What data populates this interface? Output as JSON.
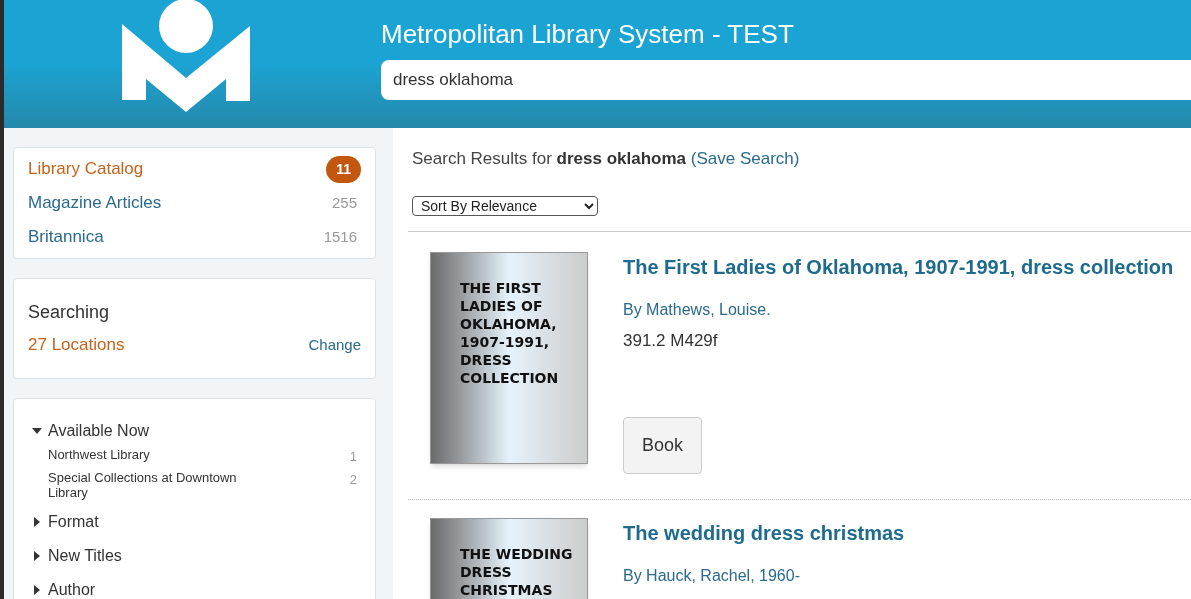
{
  "header": {
    "title": "Metropolitan Library System - TEST",
    "search": {
      "value": "dress oklahoma"
    }
  },
  "sources": [
    {
      "label": "Library Catalog",
      "count": "11",
      "selected": true
    },
    {
      "label": "Magazine Articles",
      "count": "255",
      "selected": false
    },
    {
      "label": "Britannica",
      "count": "1516",
      "selected": false
    }
  ],
  "searching": {
    "label": "Searching",
    "locations": "27 Locations",
    "change": "Change"
  },
  "facets": [
    {
      "label": "Available Now",
      "expanded": true,
      "children": [
        {
          "label": "Northwest Library",
          "count": "1"
        },
        {
          "label": "Special Collections at Downtown Library",
          "count": "2"
        }
      ]
    },
    {
      "label": "Format",
      "expanded": false
    },
    {
      "label": "New Titles",
      "expanded": false
    },
    {
      "label": "Author",
      "expanded": false
    }
  ],
  "results_header": {
    "prefix": "Search Results for",
    "query": "dress oklahoma",
    "save": "(Save Search)"
  },
  "sort": {
    "value": "Sort By Relevance"
  },
  "results": [
    {
      "cover": "THE FIRST LADIES OF OKLAHOMA, 1907-1991, DRESS COLLECTION",
      "title": "The First Ladies of Oklahoma, 1907-1991, dress collection",
      "author": "By Mathews, Louise.",
      "call_number": "391.2 M429f",
      "format": "Book"
    },
    {
      "cover": "THE WEDDING DRESS CHRISTMAS",
      "title": "The wedding dress christmas",
      "author": "By Hauck, Rachel, 1960-"
    }
  ]
}
